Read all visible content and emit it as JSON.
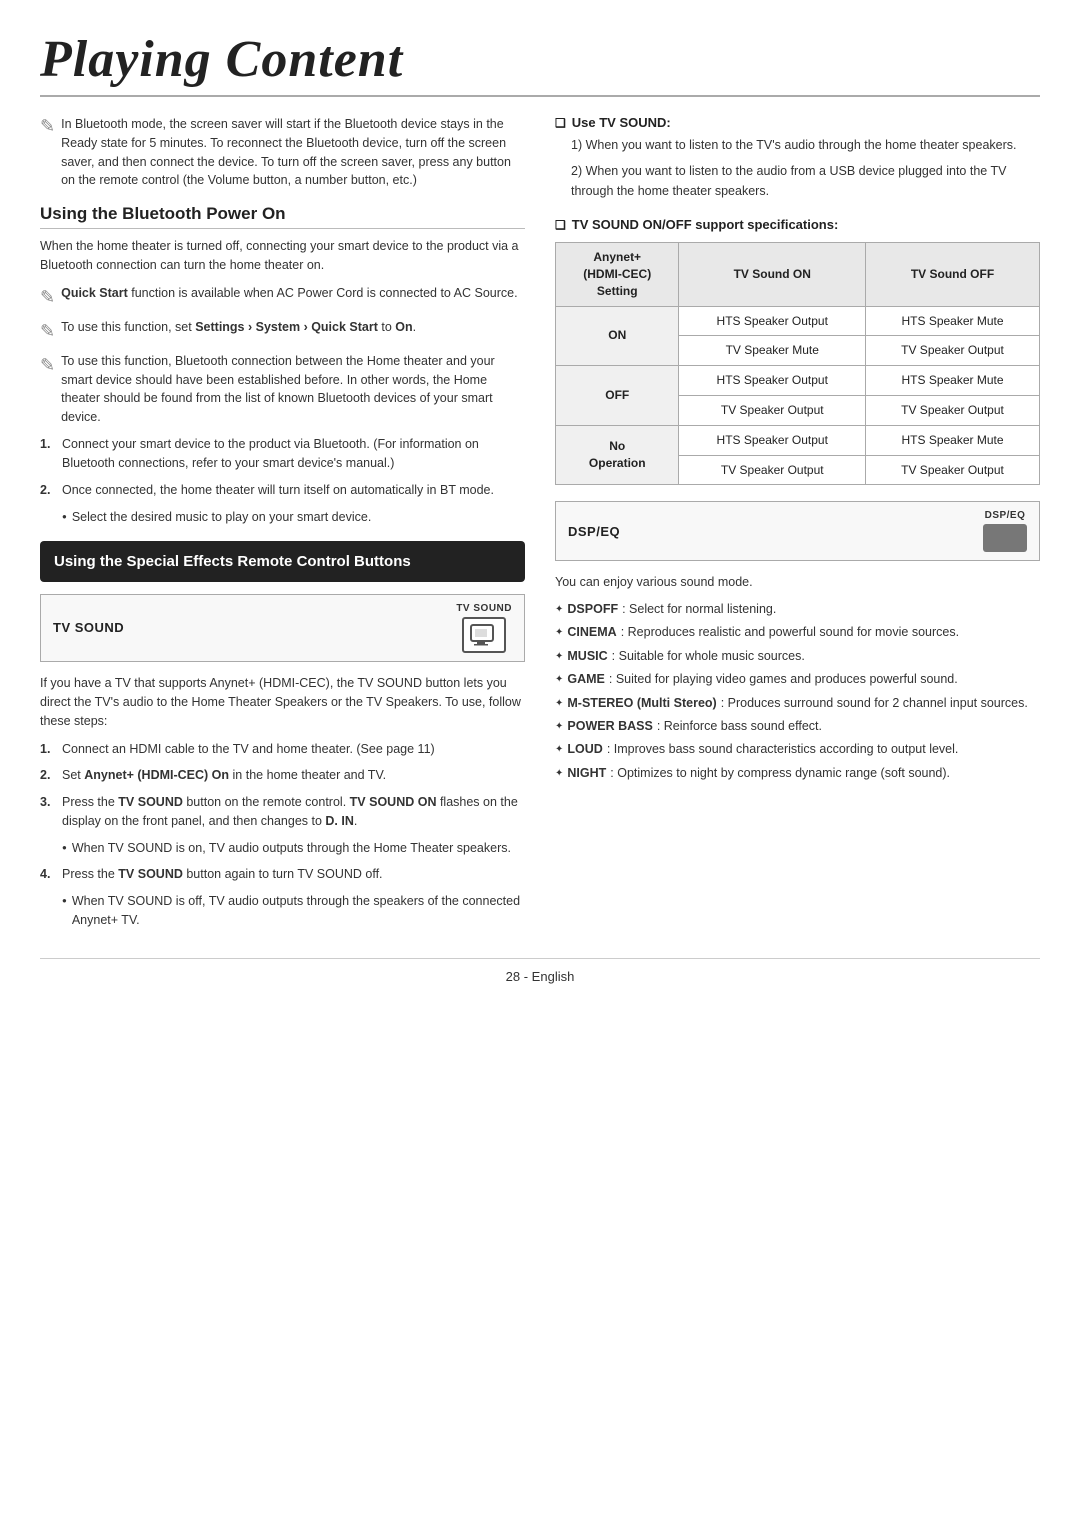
{
  "page": {
    "title": "Playing Content",
    "footer": "28 - English"
  },
  "left_col": {
    "bluetooth_note": "In Bluetooth mode, the screen saver will start if the Bluetooth device stays in the Ready state for 5 minutes. To reconnect the Bluetooth device, turn off the screen saver, and then connect the device. To turn off the screen saver, press any button on the remote control (the Volume button, a number button, etc.)",
    "bluetooth_section_title": "Using the Bluetooth Power On",
    "bluetooth_body": "When the home theater is turned off, connecting your smart device to the product via a Bluetooth connection can turn the home theater on.",
    "bullets": [
      {
        "text_html": "<b>Quick Start</b> function is available when AC Power Cord is connected to AC Source."
      },
      {
        "text_html": "To use this function, set <b>Settings › System › Quick Start</b> to <b>On</b>."
      },
      {
        "text_html": "To use this function, Bluetooth connection between the Home theater and your smart device should have been established before. In other words, the Home theater should be found from the list of known Bluetooth devices of your smart device."
      }
    ],
    "steps": [
      {
        "num": "1.",
        "text": "Connect your smart device to the product via Bluetooth. (For information on Bluetooth connections, refer to your smart device's manual.)"
      },
      {
        "num": "2.",
        "text": "Once connected, the home theater will turn itself on automatically in BT mode.",
        "sub": "Select the desired music to play on your smart device."
      }
    ],
    "special_effects_box_title": "Using the Special Effects Remote Control Buttons",
    "tv_sound_label": "TV SOUND",
    "tv_sound_button_label": "TV SOUND",
    "tv_sound_description": "If you have a TV that supports Anynet+ (HDMI-CEC), the TV SOUND button lets you direct the TV's audio to the Home Theater Speakers or the TV Speakers. To use, follow these steps:",
    "tv_sound_steps": [
      {
        "num": "1.",
        "text": "Connect an HDMI cable to the TV and home theater. (See page 11)"
      },
      {
        "num": "2.",
        "text_html": "Set <b>Anynet+ (HDMI-CEC) On</b> in the home theater and TV."
      },
      {
        "num": "3.",
        "text_html": "Press the <b>TV SOUND</b> button on the remote control. <b>TV SOUND ON</b> flashes on the display on the front panel, and then changes to <b>D. IN</b>.",
        "sub_html": "When TV SOUND is on, TV audio outputs through the Home Theater speakers."
      },
      {
        "num": "4.",
        "text_html": "Press the <b>TV SOUND</b> button again to turn TV SOUND off.",
        "sub": "When TV SOUND is off, TV audio outputs through the speakers of the connected Anynet+ TV."
      }
    ]
  },
  "right_col": {
    "use_tv_sound_heading": "Use TV SOUND:",
    "use_tv_sound_items": [
      "When you want to listen to the TV's audio through the home theater speakers.",
      "When you want to listen to the audio from a USB device plugged into the TV through the home theater speakers."
    ],
    "support_spec_heading": "TV SOUND ON/OFF support specifications:",
    "table_headers": [
      "Anynet+ (HDMI-CEC) Setting",
      "TV Sound ON",
      "TV Sound OFF"
    ],
    "table_rows": [
      {
        "row_label": "ON",
        "col1_top": "HTS Speaker Output",
        "col1_bot": "TV Speaker Mute",
        "col2_top": "HTS Speaker Mute",
        "col2_bot": "TV Speaker Output"
      },
      {
        "row_label": "OFF",
        "col1_top": "HTS Speaker Output",
        "col1_bot": "TV Speaker Output",
        "col2_top": "HTS Speaker Mute",
        "col2_bot": "TV Speaker Output"
      },
      {
        "row_label": "No Operation",
        "col1_top": "HTS Speaker Output",
        "col1_bot": "TV Speaker Output",
        "col2_top": "HTS Speaker Mute",
        "col2_bot": "TV Speaker Output"
      }
    ],
    "dsp_eq_label": "DSP/EQ",
    "dsp_eq_button_label": "DSP/EQ",
    "sound_mode_intro": "You can enjoy various sound mode.",
    "sound_modes": [
      {
        "key": "DSPOFF",
        "desc": ": Select for normal listening."
      },
      {
        "key": "CINEMA",
        "desc": ": Reproduces realistic and powerful sound for movie sources."
      },
      {
        "key": "MUSIC",
        "desc": ": Suitable for whole music sources."
      },
      {
        "key": "GAME",
        "desc": ": Suited for playing video games and produces powerful sound."
      },
      {
        "key": "M-STEREO (Multi Stereo)",
        "desc": ": Produces surround sound for 2 channel input sources."
      },
      {
        "key": "POWER BASS",
        "desc": ": Reinforce bass sound effect."
      },
      {
        "key": "LOUD",
        "desc": ": Improves bass sound characteristics according to output level."
      },
      {
        "key": "NIGHT",
        "desc": ": Optimizes to night by compress dynamic range (soft sound)."
      }
    ]
  }
}
